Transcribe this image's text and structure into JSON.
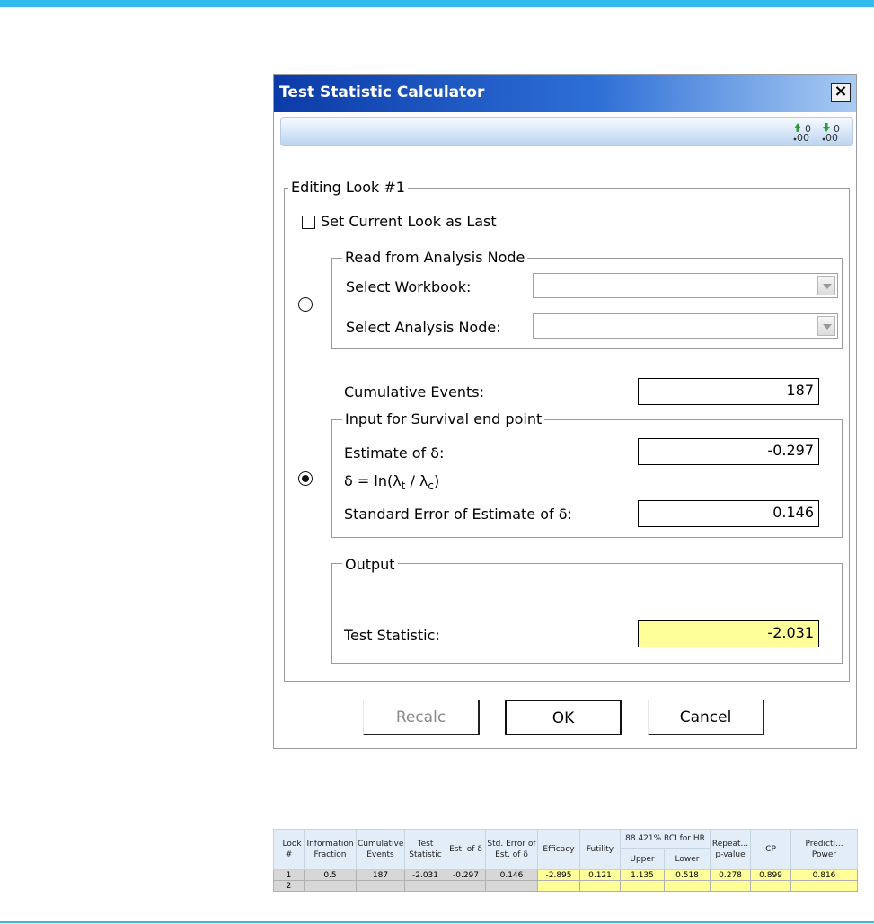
{
  "dialog": {
    "title": "Test Statistic Calculator",
    "close_glyph": "×",
    "toolbar": {
      "icons": [
        "increase-decimal-icon",
        "decrease-decimal-icon"
      ]
    },
    "editing_group_label": "Editing Look #1",
    "set_last_label": "Set Current Look as Last",
    "set_last_checked": false,
    "read_group_label": "Read from Analysis Node",
    "select_workbook_label": "Select Workbook:",
    "select_workbook_value": "",
    "select_node_label": "Select Analysis Node:",
    "select_node_value": "",
    "read_selected": false,
    "cumulative_events_label": "Cumulative Events:",
    "cumulative_events_value": "187",
    "input_group_label": "Input for Survival end point",
    "estimate_label": "Estimate of δ:",
    "estimate_value": "-0.297",
    "delta_formula": {
      "prefix": "δ = ln(λ",
      "sub_t": "t",
      "mid": " / λ",
      "sub_c": "c",
      "suffix": ")"
    },
    "se_label": "Standard Error of Estimate of δ:",
    "se_value": "0.146",
    "manual_selected": true,
    "output_group_label": "Output",
    "test_statistic_label": "Test Statistic:",
    "test_statistic_value": "-2.031",
    "buttons": {
      "recalc": "Recalc",
      "ok": "OK",
      "cancel": "Cancel"
    }
  },
  "grid": {
    "headers": {
      "look": "Look #",
      "info_fraction": "Information Fraction",
      "cum_events": "Cumulative Events",
      "test_stat": "Test Statistic",
      "est_delta": "Est. of δ",
      "se_delta": "Std. Error of Est. of δ",
      "efficacy": "Efficacy",
      "futility": "Futility",
      "rci": "88.421% RCI for HR",
      "upper": "Upper",
      "lower": "Lower",
      "repeat_p": "Repeat... p-value",
      "cp": "CP",
      "pred_power": "Predicti... Power"
    },
    "rows": [
      {
        "look": "1",
        "info_fraction": "0.5",
        "cum_events": "187",
        "test_stat": "-2.031",
        "est_delta": "-0.297",
        "se_delta": "0.146",
        "efficacy": "-2.895",
        "futility": "0.121",
        "upper": "1.135",
        "lower": "0.518",
        "repeat_p": "0.278",
        "cp": "0.899",
        "pred_power": "0.816"
      },
      {
        "look": "2",
        "info_fraction": "",
        "cum_events": "",
        "test_stat": "",
        "est_delta": "",
        "se_delta": "",
        "efficacy": "",
        "futility": "",
        "upper": "",
        "lower": "",
        "repeat_p": "",
        "cp": "",
        "pred_power": ""
      }
    ]
  }
}
